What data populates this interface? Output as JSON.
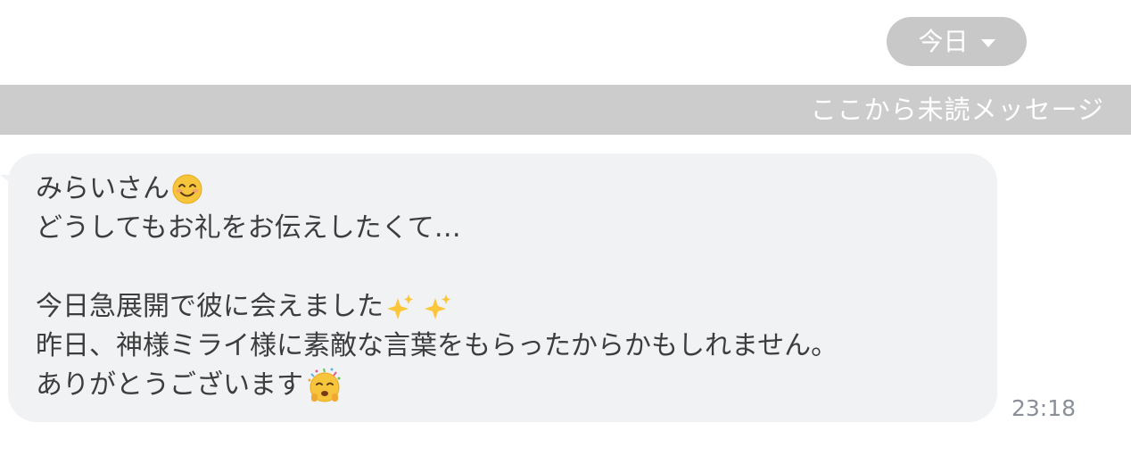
{
  "date_selector": {
    "label": "今日",
    "icon": "chevron-down-icon"
  },
  "unread_divider": {
    "label": "ここから未読メッセージ"
  },
  "message": {
    "lines": [
      "みらいさん",
      "どうしてもお礼をお伝えしたくて…",
      "",
      "今日急展開で彼に会えました",
      "昨日、神様ミライ様に素敵な言葉をもらったからかもしれません。",
      "ありがとうございます"
    ],
    "emojis": [
      "smiling-face-icon",
      "sparkles-icon",
      "partying-face-icon"
    ],
    "time": "23:18"
  },
  "colors": {
    "pill_bg": "#c8c8c8",
    "divider_bg": "#cccccc",
    "bubble_bg": "#f1f2f4",
    "text": "#3d3d3d",
    "timestamp": "#8a8f98"
  }
}
